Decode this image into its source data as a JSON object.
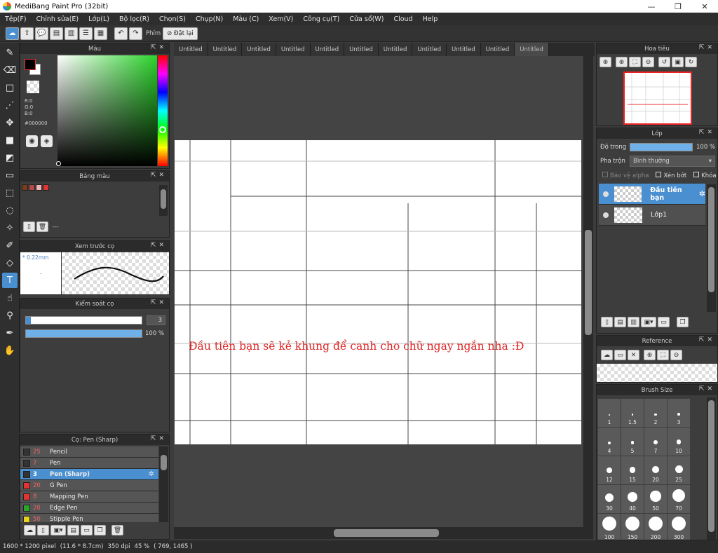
{
  "window": {
    "title": "MediBang Paint Pro (32bit)",
    "minimize": "—",
    "maximize": "❐",
    "close": "✕"
  },
  "menu": [
    "Tệp(F)",
    "Chỉnh sửa(E)",
    "Lớp(L)",
    "Bộ lọc(R)",
    "Chọn(S)",
    "Chụp(N)",
    "Màu (C)",
    "Xem(V)",
    "Công cụ(T)",
    "Cửa sổ(W)",
    "Cloud",
    "Help"
  ],
  "toolbar": {
    "shortcut_label": "Phím",
    "reset_label": "Đặt lại"
  },
  "tabs": [
    "Untitled",
    "Untitled",
    "Untitled",
    "Untitled",
    "Untitled",
    "Untitled",
    "Untitled",
    "Untitled",
    "Untitled",
    "Untitled",
    "Untitled"
  ],
  "color_panel": {
    "title": "Màu",
    "r": "R:0",
    "g": "G:0",
    "b": "B:0",
    "hex": "#000000"
  },
  "palette_panel": {
    "title": "Bảng màu",
    "info": "---",
    "swatches": [
      "#7a3b1e",
      "#b34a4a",
      "#f0b4b4",
      "#e03434"
    ]
  },
  "brush_preview": {
    "title": "Xem trước cọ",
    "size": "* 0.22mm"
  },
  "brush_control": {
    "title": "Kiểm soát cọ",
    "size_value": "3",
    "size_fraction": 0.01,
    "opacity_value": "100 %",
    "opacity_fraction": 1.0
  },
  "brush_list": {
    "title": "Cọ: Pen (Sharp)",
    "items": [
      {
        "size": "25",
        "name": "Pencil",
        "color": "#333333"
      },
      {
        "size": "7",
        "name": "Pen",
        "color": "#333333"
      },
      {
        "size": "3",
        "name": "Pen (Sharp)",
        "color": "#333333"
      },
      {
        "size": "20",
        "name": "G Pen",
        "color": "#e03434"
      },
      {
        "size": "8",
        "name": "Mapping Pen",
        "color": "#e03434"
      },
      {
        "size": "20",
        "name": "Edge Pen",
        "color": "#2aa52a"
      },
      {
        "size": "50",
        "name": "Stipple Pen",
        "color": "#e8d020"
      }
    ]
  },
  "canvas": {
    "text": "Đầu tiên bạn sẽ kẻ khung để canh cho chữ ngay ngắn nha :Đ"
  },
  "navigator": {
    "title": "Hoa tiêu"
  },
  "layer_panel": {
    "title": "Lớp",
    "opacity_label": "Độ trong",
    "opacity_value": "100 %",
    "opacity_fraction": 1.0,
    "blend_label": "Pha trộn",
    "blend_value": "Bình thường",
    "protect_alpha": "Bảo vệ alpha",
    "clipping": "Xén bớt",
    "lock": "Khóa",
    "layers": [
      {
        "name": "Đầu tiên bạn",
        "selected": true
      },
      {
        "name": "Lớp1",
        "selected": false
      }
    ]
  },
  "reference_panel": {
    "title": "Reference"
  },
  "brush_size_panel": {
    "title": "Brush Size",
    "sizes": [
      "1",
      "1.5",
      "2",
      "3",
      "4",
      "5",
      "7",
      "10",
      "12",
      "15",
      "20",
      "25",
      "30",
      "40",
      "50",
      "70",
      "100",
      "150",
      "200",
      "300"
    ]
  },
  "status": {
    "dimensions": "1600 * 1200 pixel",
    "physical": "(11.6 * 8.7cm)",
    "dpi": "350 dpi",
    "zoom": "45 %",
    "coords": "( 769, 1465 )"
  }
}
